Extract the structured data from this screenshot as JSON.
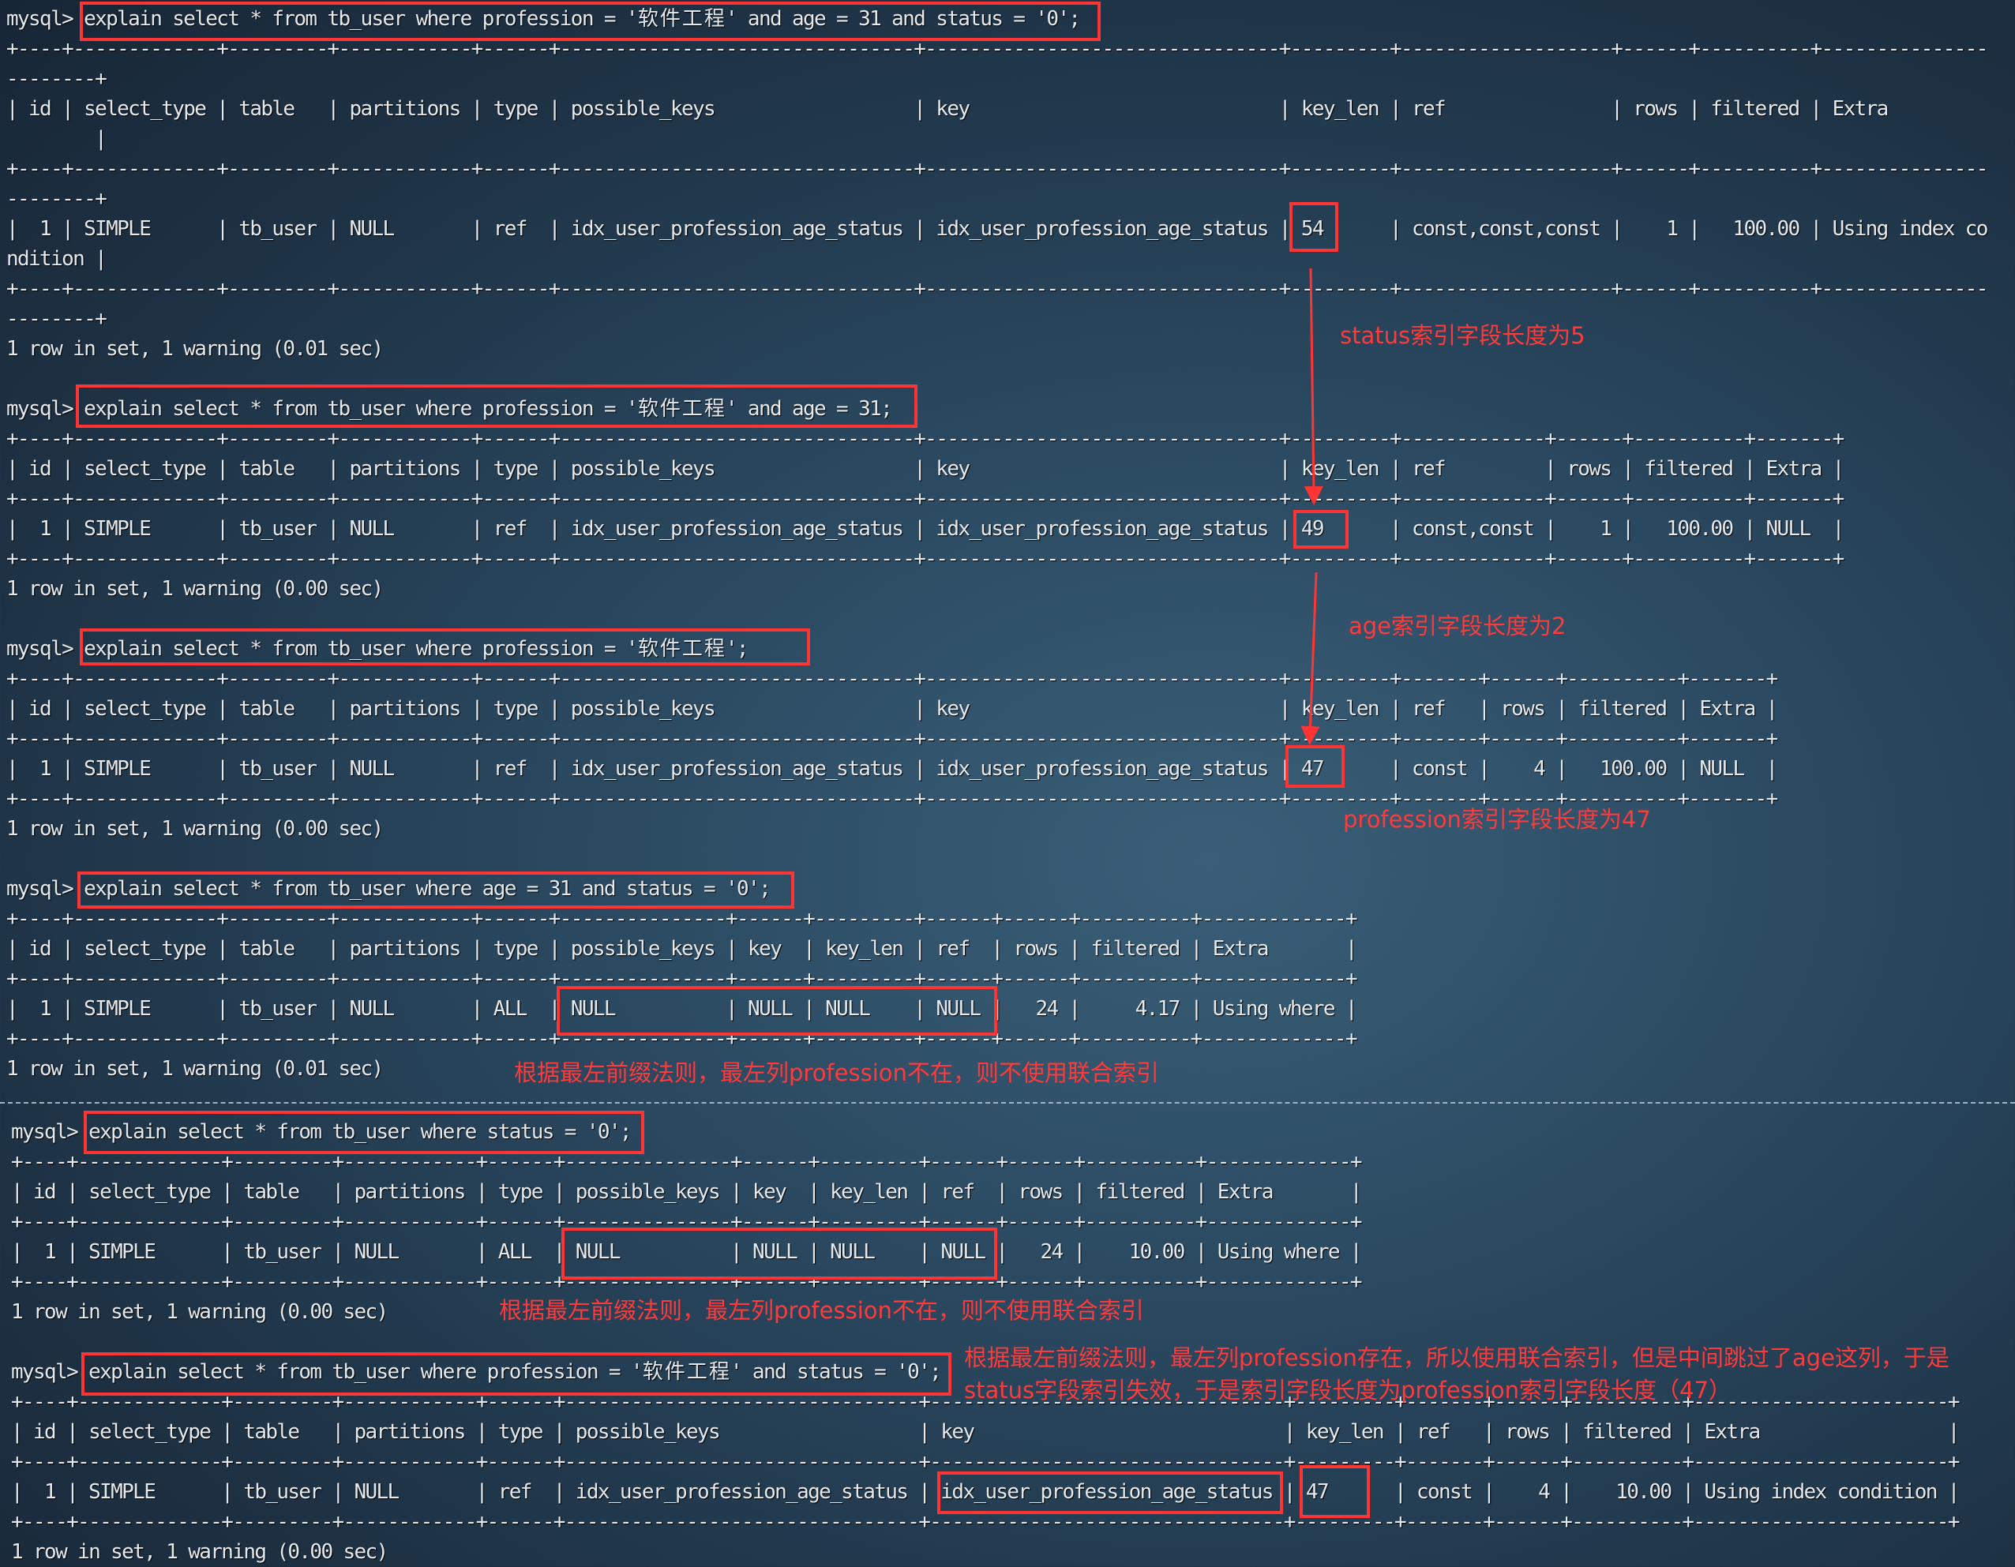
{
  "prompt": "mysql>",
  "wrap_columns": 179,
  "accent_color": "#ff3434",
  "parts": [
    {
      "blocks": [
        {
          "command": "explain select * from tb_user where profession = '软件工程' and age = 31 and status = '0';",
          "columns": [
            "id",
            "select_type",
            "table",
            "partitions",
            "type",
            "possible_keys",
            "key",
            "key_len",
            "ref",
            "rows",
            "filtered",
            "Extra"
          ],
          "rows": [
            [
              "1",
              "SIMPLE",
              "tb_user",
              "NULL",
              "ref",
              "idx_user_profession_age_status",
              "idx_user_profession_age_status",
              "54",
              "const,const,const",
              "1",
              "100.00",
              "Using index condition"
            ]
          ],
          "footer": "1 row in set, 1 warning (0.01 sec)"
        },
        {
          "command": "explain select * from tb_user where profession = '软件工程' and age = 31;",
          "columns": [
            "id",
            "select_type",
            "table",
            "partitions",
            "type",
            "possible_keys",
            "key",
            "key_len",
            "ref",
            "rows",
            "filtered",
            "Extra"
          ],
          "rows": [
            [
              "1",
              "SIMPLE",
              "tb_user",
              "NULL",
              "ref",
              "idx_user_profession_age_status",
              "idx_user_profession_age_status",
              "49",
              "const,const",
              "1",
              "100.00",
              "NULL"
            ]
          ],
          "footer": "1 row in set, 1 warning (0.00 sec)"
        },
        {
          "command": "explain select * from tb_user where profession = '软件工程';",
          "columns": [
            "id",
            "select_type",
            "table",
            "partitions",
            "type",
            "possible_keys",
            "key",
            "key_len",
            "ref",
            "rows",
            "filtered",
            "Extra"
          ],
          "rows": [
            [
              "1",
              "SIMPLE",
              "tb_user",
              "NULL",
              "ref",
              "idx_user_profession_age_status",
              "idx_user_profession_age_status",
              "47",
              "const",
              "4",
              "100.00",
              "NULL"
            ]
          ],
          "footer": "1 row in set, 1 warning (0.00 sec)"
        },
        {
          "command": "explain select * from tb_user where age = 31 and status = '0';",
          "columns": [
            "id",
            "select_type",
            "table",
            "partitions",
            "type",
            "possible_keys",
            "key",
            "key_len",
            "ref",
            "rows",
            "filtered",
            "Extra"
          ],
          "rows": [
            [
              "1",
              "SIMPLE",
              "tb_user",
              "NULL",
              "ALL",
              "NULL",
              "NULL",
              "NULL",
              "NULL",
              "24",
              "4.17",
              "Using where"
            ]
          ],
          "footer": "1 row in set, 1 warning (0.01 sec)"
        }
      ]
    },
    {
      "blocks": [
        {
          "command": "explain select * from tb_user where status = '0';",
          "columns": [
            "id",
            "select_type",
            "table",
            "partitions",
            "type",
            "possible_keys",
            "key",
            "key_len",
            "ref",
            "rows",
            "filtered",
            "Extra"
          ],
          "rows": [
            [
              "1",
              "SIMPLE",
              "tb_user",
              "NULL",
              "ALL",
              "NULL",
              "NULL",
              "NULL",
              "NULL",
              "24",
              "10.00",
              "Using where"
            ]
          ],
          "footer": "1 row in set, 1 warning (0.00 sec)"
        },
        {
          "command": "explain select * from tb_user where profession = '软件工程' and status = '0';",
          "columns": [
            "id",
            "select_type",
            "table",
            "partitions",
            "type",
            "possible_keys",
            "key",
            "key_len",
            "ref",
            "rows",
            "filtered",
            "Extra"
          ],
          "rows": [
            [
              "1",
              "SIMPLE",
              "tb_user",
              "NULL",
              "ref",
              "idx_user_profession_age_status",
              "idx_user_profession_age_status",
              "47",
              "const",
              "4",
              "10.00",
              "Using index condition"
            ]
          ],
          "footer": "1 row in set, 1 warning (0.00 sec)"
        }
      ]
    }
  ],
  "annotations": {
    "status_len": "status索引字段长度为5",
    "age_len": "age索引字段长度为2",
    "profession_len": "profession索引字段长度为47",
    "no_leftmost_1": "根据最左前缀法则，最左列profession不在，则不使用联合索引",
    "no_leftmost_2": "根据最左前缀法则，最左列profession不在，则不使用联合索引",
    "skip_age_line1": "根据最左前缀法则，最左列profession存在，所以使用联合索引，但是中间跳过了age这列，于是",
    "skip_age_line2": "status字段索引失效，于是索引字段长度为profession索引字段长度（47）"
  }
}
